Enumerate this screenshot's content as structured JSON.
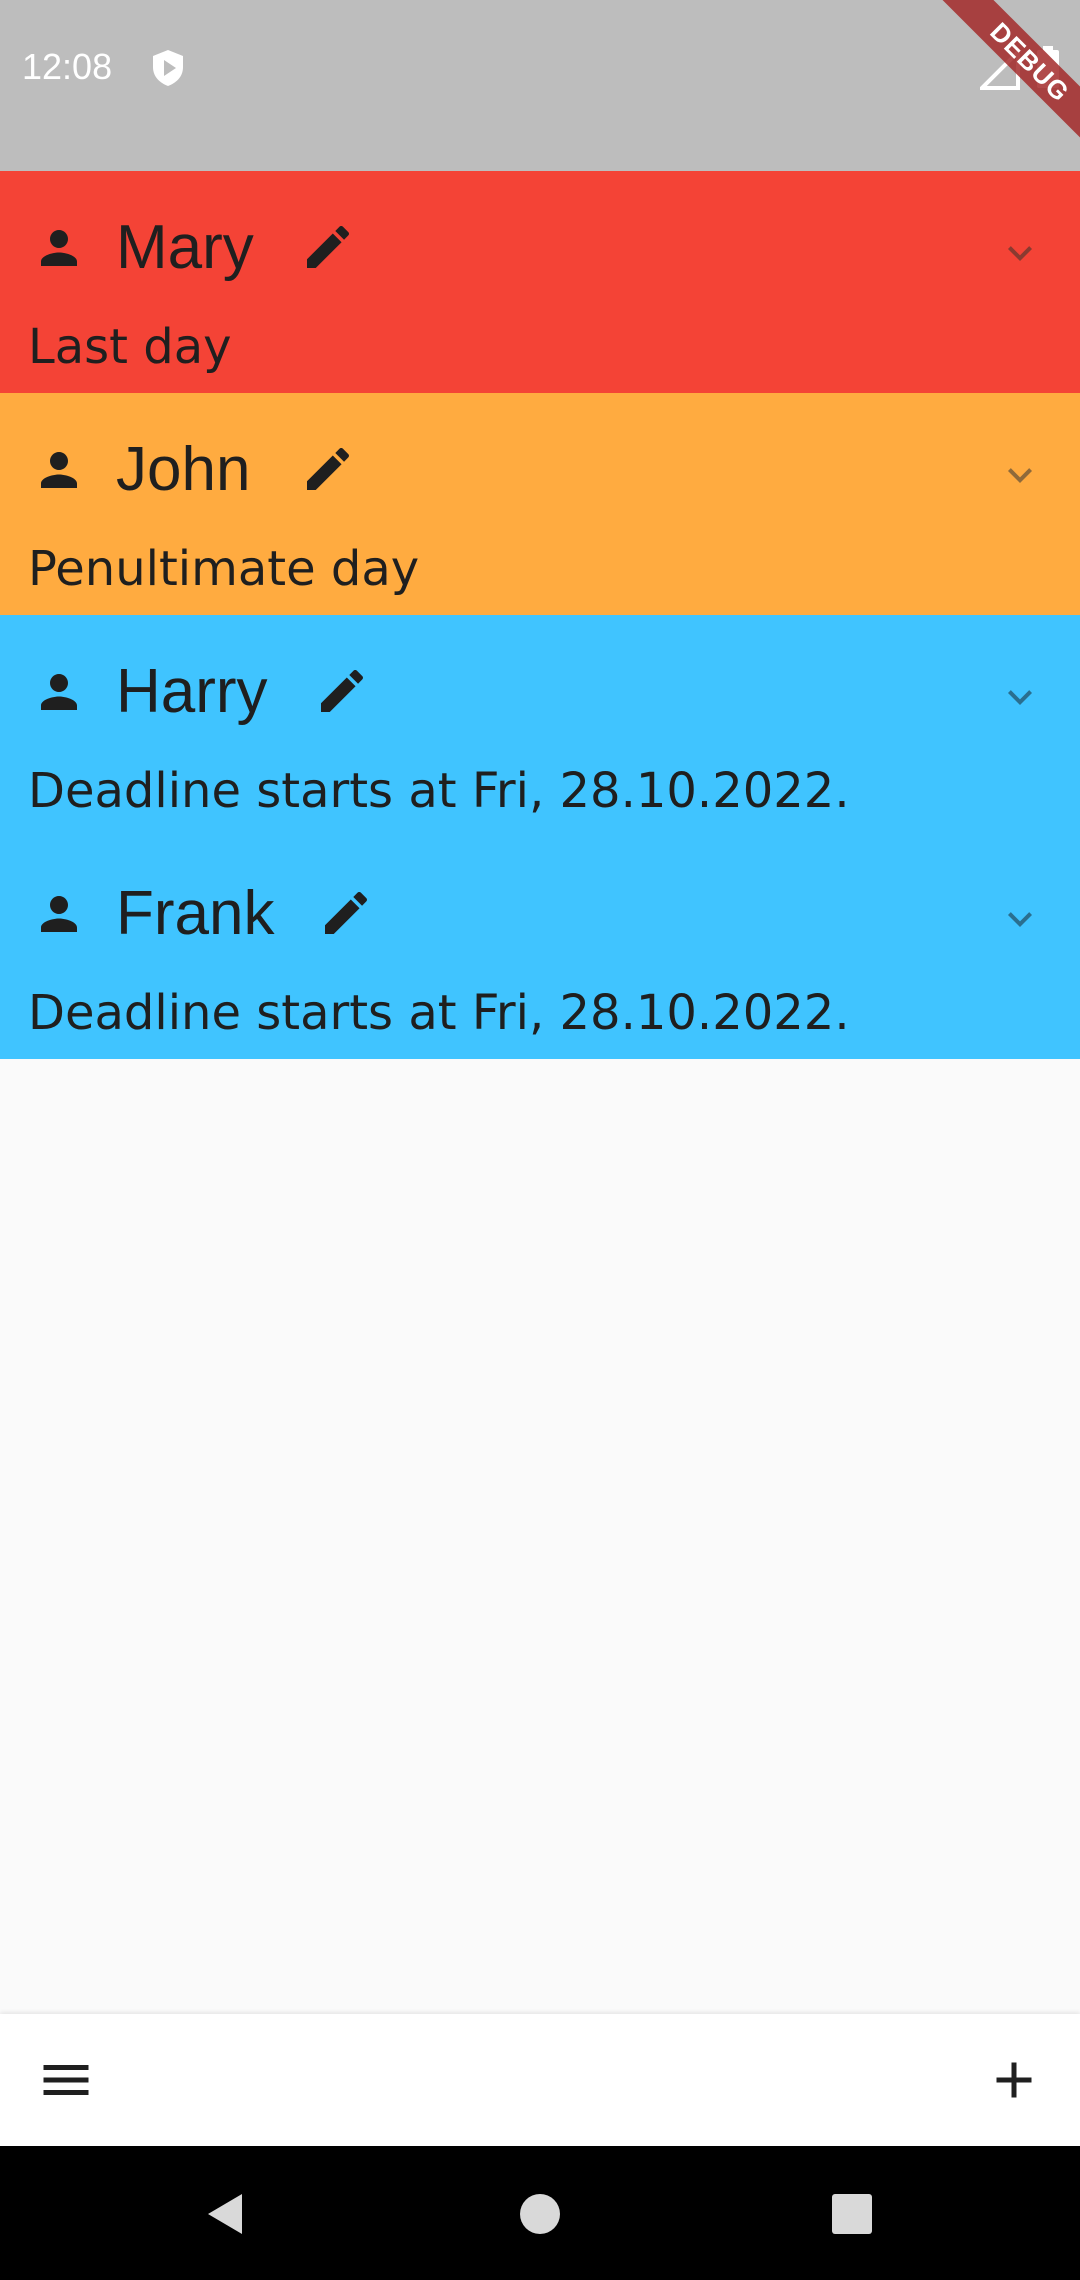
{
  "status_bar": {
    "time": "12:08",
    "icons": [
      "shield-play-icon",
      "signal-icon",
      "battery-icon"
    ],
    "debug_banner": "DEBUG",
    "background": "#bdbdbd"
  },
  "list": {
    "items": [
      {
        "name": "Mary",
        "subtitle": "Last day",
        "color": "#f44336",
        "icons": [
          "person-icon",
          "edit-icon",
          "chevron-down-icon"
        ]
      },
      {
        "name": "John",
        "subtitle": "Penultimate day",
        "color": "#ffab40",
        "icons": [
          "person-icon",
          "edit-icon",
          "chevron-down-icon"
        ]
      },
      {
        "name": "Harry",
        "subtitle": "Deadline starts at Fri, 28.10.2022.",
        "color": "#40c4ff",
        "icons": [
          "person-icon",
          "edit-icon",
          "chevron-down-icon"
        ]
      },
      {
        "name": "Frank",
        "subtitle": "Deadline starts at Fri, 28.10.2022.",
        "color": "#40c4ff",
        "icons": [
          "person-icon",
          "edit-icon",
          "chevron-down-icon"
        ]
      }
    ]
  },
  "bottom_bar": {
    "left_icon": "menu-icon",
    "right_icon": "add-icon"
  },
  "nav_bar": {
    "icons": [
      "back-icon",
      "home-icon",
      "recents-icon"
    ]
  }
}
